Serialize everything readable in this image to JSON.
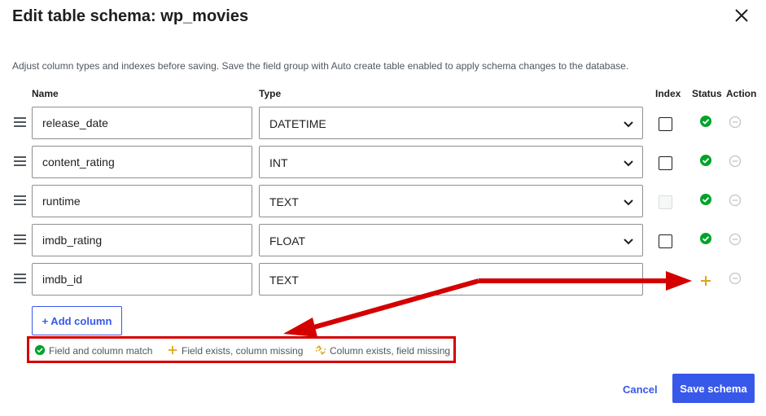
{
  "dialog": {
    "title": "Edit table schema: wp_movies",
    "description": "Adjust column types and indexes before saving. Save the field group with Auto create table enabled to apply schema changes to the database."
  },
  "headers": {
    "name": "Name",
    "type": "Type",
    "index": "Index",
    "status": "Status",
    "action": "Action"
  },
  "rows": [
    {
      "name": "release_date",
      "type": "DATETIME",
      "index": "unchecked",
      "status": "match"
    },
    {
      "name": "content_rating",
      "type": "INT",
      "index": "unchecked",
      "status": "match"
    },
    {
      "name": "runtime",
      "type": "TEXT",
      "index": "disabled",
      "status": "match"
    },
    {
      "name": "imdb_rating",
      "type": "FLOAT",
      "index": "unchecked",
      "status": "match"
    },
    {
      "name": "imdb_id",
      "type": "TEXT",
      "index": "hidden",
      "status": "column-missing"
    }
  ],
  "add_column_label": "+ Add column",
  "legend": {
    "match": "Field and column match",
    "column_missing": "Field exists, column missing",
    "field_missing": "Column exists, field missing"
  },
  "footer": {
    "cancel_label": "Cancel",
    "save_label": "Save schema"
  },
  "colors": {
    "accent": "#3858e9",
    "status_match": "#00a32a",
    "status_missing": "#dba617",
    "annotation": "#d40000"
  },
  "icons": {
    "close": "close-icon",
    "drag": "drag-handle-icon",
    "chevron": "chevron-down-icon",
    "match": "check-circle-icon",
    "column_missing": "plus-icon",
    "field_missing": "broken-link-icon",
    "remove": "minus-circle-icon"
  }
}
